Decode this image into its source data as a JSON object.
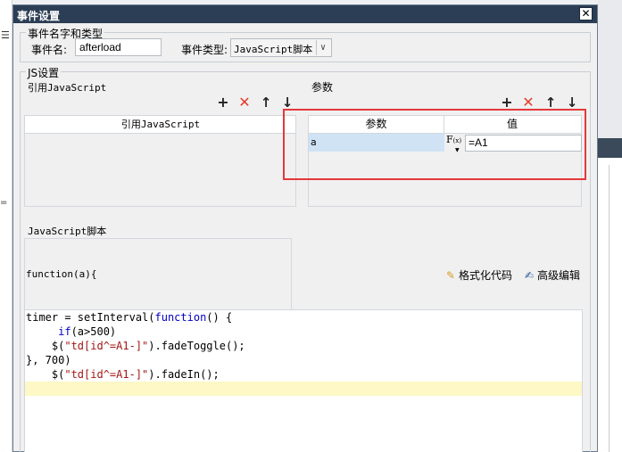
{
  "dialog": {
    "title": "事件设置",
    "close_glyph": "✕"
  },
  "name_group": {
    "legend": "事件名字和类型",
    "name_label": "事件名:",
    "name_value": "afterload",
    "type_label": "事件类型:",
    "type_value": "JavaScript脚本"
  },
  "js_group": {
    "legend": "JS设置",
    "ref_section_label": "引用JavaScript",
    "ref_table_header": "引用JavaScript",
    "param_section_label": "参数",
    "param_table": {
      "headers": [
        "参数",
        "值"
      ],
      "rows": [
        {
          "name": "a",
          "value": "=A1"
        }
      ]
    },
    "fx_label": "F",
    "fx_sub": "(x)",
    "script_label": "JavaScript脚本",
    "function_signature": "function(a){",
    "format_button": "格式化代码",
    "advanced_button": "高级编辑",
    "code_lines": [
      [
        "timer = setInterval(",
        "function",
        "() {"
      ],
      [
        "     ",
        "if",
        "(a>500)"
      ],
      [
        "    $(",
        "\"td[id^=A1-]\"",
        ").fadeToggle();"
      ],
      [
        "}, 700)",
        "",
        ""
      ],
      [
        "    $(",
        "\"td[id^=A1-]\"",
        ").fadeIn();"
      ]
    ]
  },
  "toolbar": {
    "add": "+",
    "delete": "✕",
    "up": "↑",
    "down": "↓"
  },
  "colors": {
    "titlebar": "#2c3e55",
    "highlight_border": "#e5383b",
    "delete_icon": "#e53b2c",
    "selected_row": "#cfe3f5",
    "current_line": "#fdf8c6"
  }
}
